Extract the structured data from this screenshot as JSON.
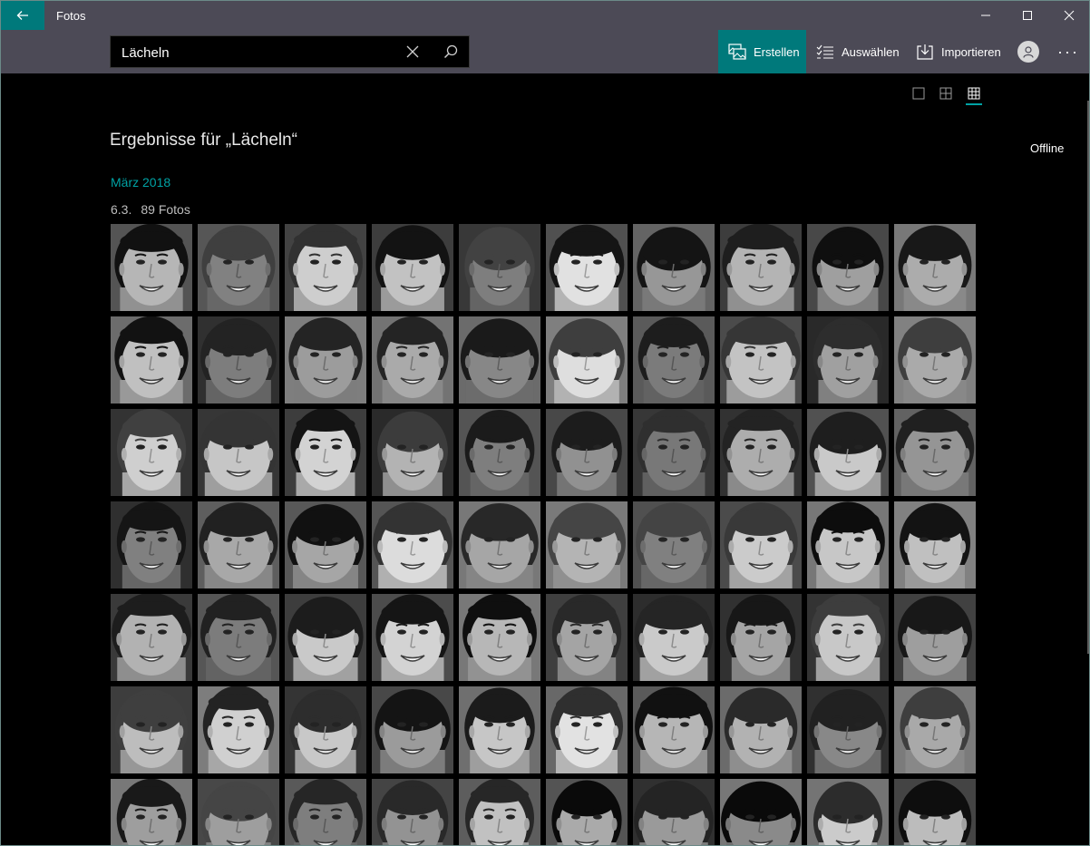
{
  "app": {
    "title": "Fotos"
  },
  "search": {
    "value": "Lächeln"
  },
  "toolbar": {
    "create_label": "Erstellen",
    "select_label": "Auswählen",
    "import_label": "Importieren",
    "more_label": "···"
  },
  "view_options": [
    "single",
    "medium",
    "small"
  ],
  "view_selected": "small",
  "results": {
    "title": "Ergebnisse für „Lächeln“",
    "month": "März 2018",
    "date": "6.3.",
    "count": "89 Fotos"
  },
  "status": {
    "offline": "Offline"
  },
  "photos": {
    "rows": 7,
    "cols": 10
  },
  "colors": {
    "accent": "#00797b",
    "accent_light": "#00a2a4",
    "chrome": "#4c4a56"
  }
}
